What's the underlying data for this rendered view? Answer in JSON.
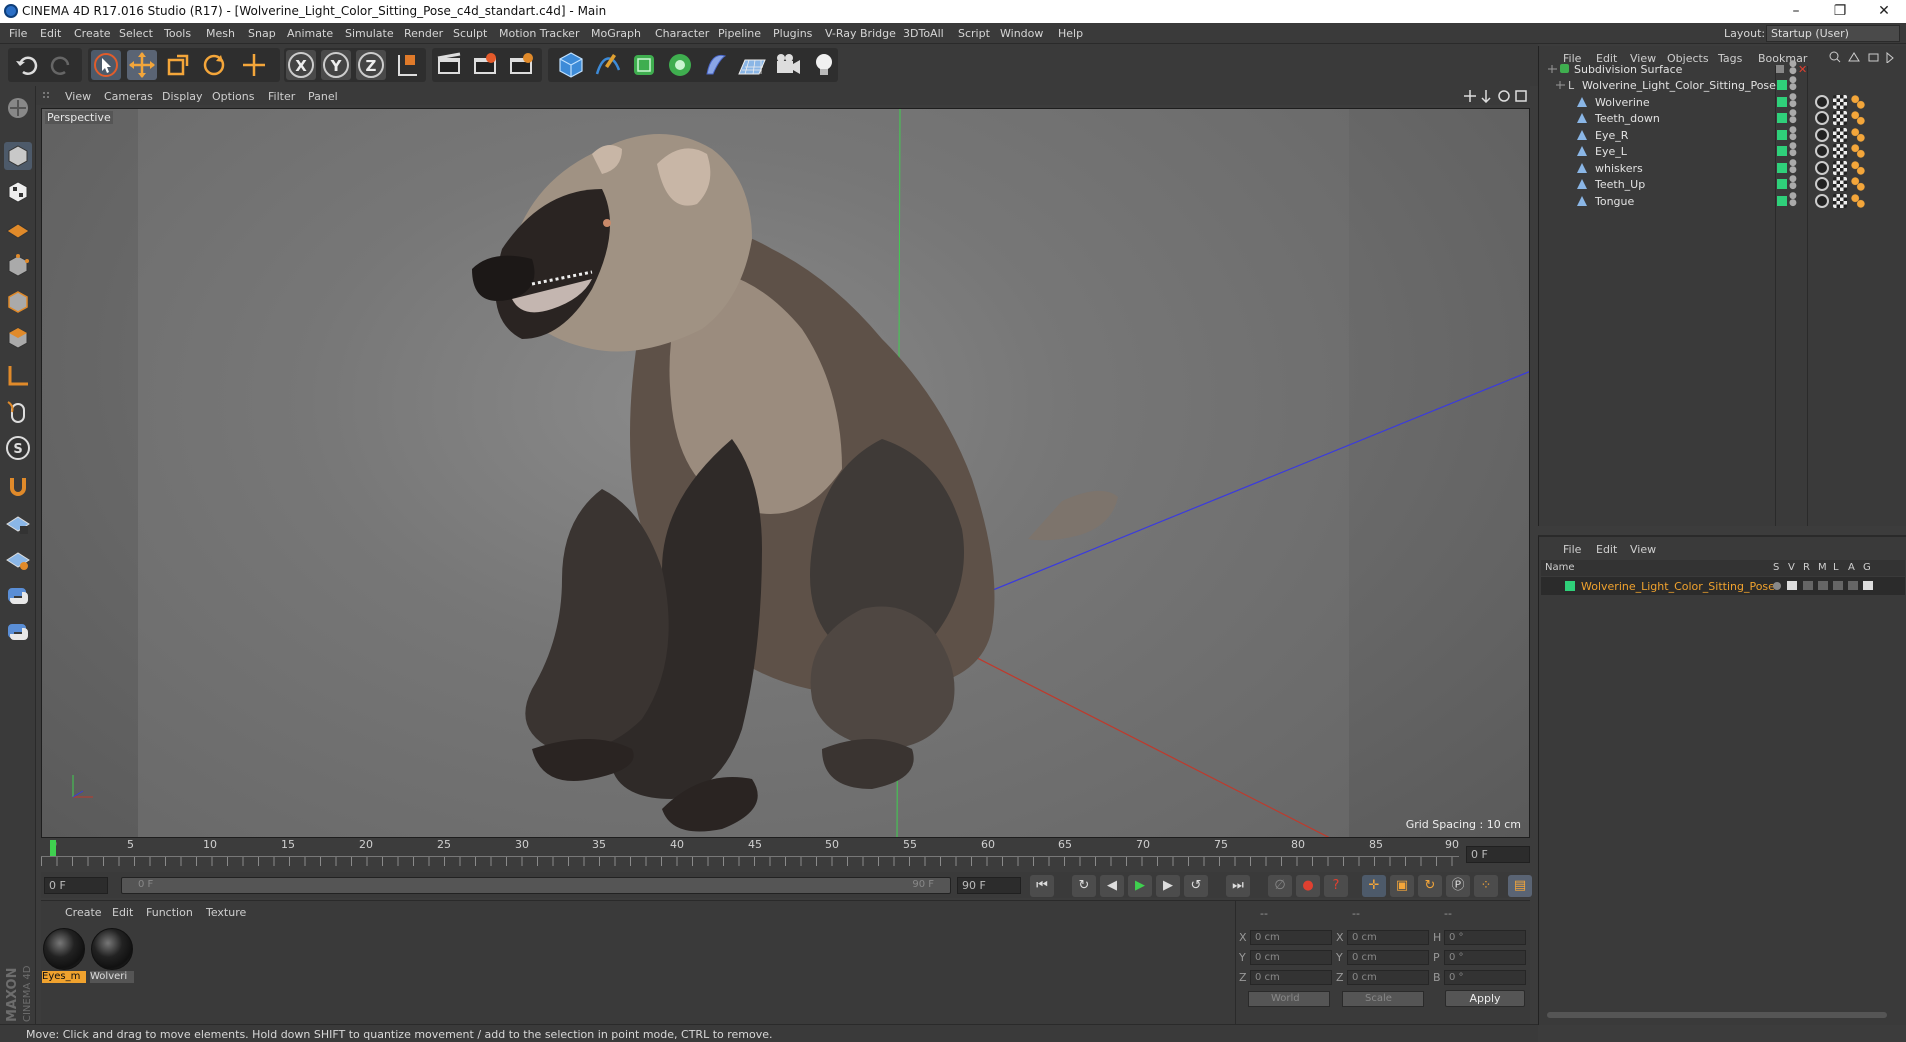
{
  "window": {
    "title": "CINEMA 4D R17.016 Studio (R17) - [Wolverine_Light_Color_Sitting_Pose_c4d_standart.c4d] - Main",
    "controls": [
      "–",
      "❐",
      "✕"
    ]
  },
  "menubar": {
    "items": [
      "File",
      "Edit",
      "Create",
      "Select",
      "Tools",
      "Mesh",
      "Snap",
      "Animate",
      "Simulate",
      "Render",
      "Sculpt",
      "Motion Tracker",
      "MoGraph",
      "Character",
      "Pipeline",
      "Plugins",
      "V-Ray Bridge",
      "3DToAll",
      "Script",
      "Window",
      "Help"
    ],
    "layout_label": "Layout:",
    "layout_value": "Startup (User)"
  },
  "viewport": {
    "menu": [
      "View",
      "Cameras",
      "Display",
      "Options",
      "Filter",
      "Panel"
    ],
    "label": "Perspective",
    "grid_spacing": "Grid Spacing : 10 cm"
  },
  "timeline": {
    "ticks": [
      "0",
      "5",
      "10",
      "15",
      "20",
      "25",
      "30",
      "35",
      "40",
      "45",
      "50",
      "55",
      "60",
      "65",
      "70",
      "75",
      "80",
      "85",
      "90"
    ],
    "current_frame": "0 F",
    "start_field": "0 F",
    "range_start": "0 F",
    "range_end": "90 F",
    "end_field": "90 F"
  },
  "material_manager": {
    "menu": [
      "Create",
      "Edit",
      "Function",
      "Texture"
    ],
    "materials": [
      {
        "name": "Eyes_m",
        "selected": true
      },
      {
        "name": "Wolveri",
        "selected": false
      }
    ]
  },
  "coordinates": {
    "headers": [
      "--",
      "--",
      "--"
    ],
    "rows": [
      {
        "a": "X",
        "av": "0 cm",
        "b": "X",
        "bv": "0 cm",
        "c": "H",
        "cv": "0 °"
      },
      {
        "a": "Y",
        "av": "0 cm",
        "b": "Y",
        "bv": "0 cm",
        "c": "P",
        "cv": "0 °"
      },
      {
        "a": "Z",
        "av": "0 cm",
        "b": "Z",
        "bv": "0 cm",
        "c": "B",
        "cv": "0 °"
      }
    ],
    "world": "World",
    "scale": "Scale",
    "apply": "Apply"
  },
  "status": "Move: Click and drag to move elements. Hold down SHIFT to quantize movement / add to the selection in point mode, CTRL to remove.",
  "object_manager": {
    "menu": [
      "File",
      "Edit",
      "View",
      "Objects",
      "Tags",
      "Bookmar"
    ],
    "root": "Subdivision Surface",
    "group": "Wolverine_Light_Color_Sitting_Pose",
    "children": [
      "Wolverine",
      "Teeth_down",
      "Eye_R",
      "Eye_L",
      "whiskers",
      "Teeth_Up",
      "Tongue"
    ]
  },
  "attribute_manager": {
    "menu": [
      "File",
      "Edit",
      "View"
    ],
    "columns": [
      "Name",
      "S",
      "V",
      "R",
      "M",
      "L",
      "A",
      "G"
    ],
    "layer": "Wolverine_Light_Color_Sitting_Pose"
  },
  "colors": {
    "accent_orange": "#f0a22e",
    "layer_green": "#2fd07a",
    "axis_x": "#c0392b",
    "axis_y": "#2ecc40",
    "axis_z": "#3a3adf"
  }
}
